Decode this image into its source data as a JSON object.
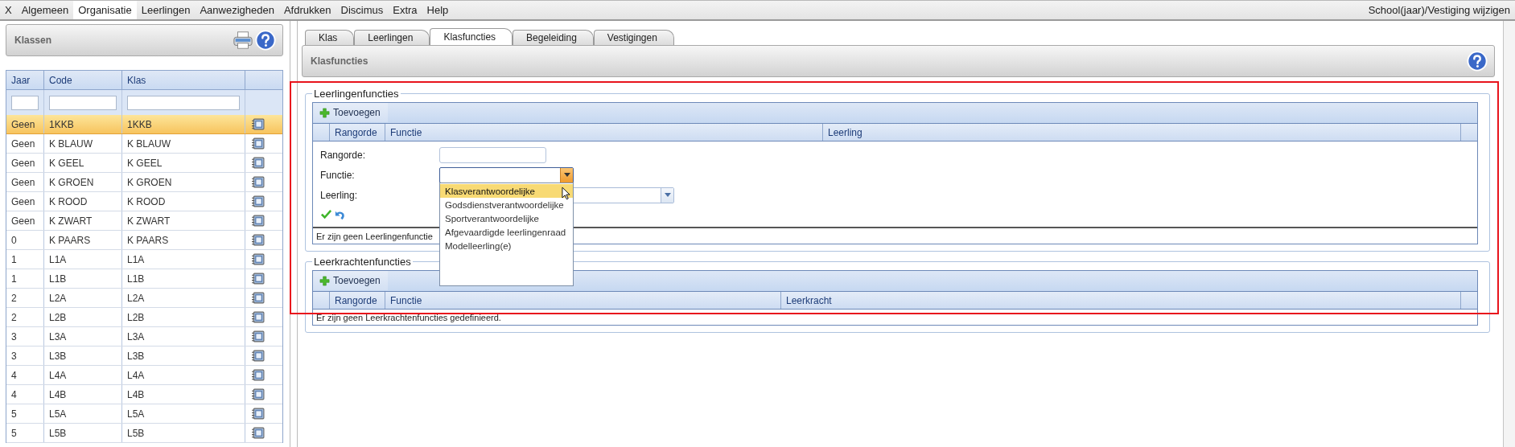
{
  "menu": [
    {
      "label": "X",
      "selected": false
    },
    {
      "label": "Algemeen",
      "selected": false
    },
    {
      "label": "Organisatie",
      "selected": true
    },
    {
      "label": "Leerlingen",
      "selected": false
    },
    {
      "label": "Aanwezigheden",
      "selected": false
    },
    {
      "label": "Afdrukken",
      "selected": false
    },
    {
      "label": "Discimus",
      "selected": false
    },
    {
      "label": "Extra",
      "selected": false
    },
    {
      "label": "Help",
      "selected": false
    }
  ],
  "menu_right": "School(jaar)/Vestiging wijzigen",
  "sidebar": {
    "title": "Klassen",
    "columns": [
      "Jaar",
      "Code",
      "Klas"
    ],
    "rows": [
      {
        "jaar": "Geen",
        "code": "1KKB",
        "klas": "1KKB",
        "selected": true
      },
      {
        "jaar": "Geen",
        "code": "K BLAUW",
        "klas": "K BLAUW",
        "selected": false
      },
      {
        "jaar": "Geen",
        "code": "K GEEL",
        "klas": "K GEEL",
        "selected": false
      },
      {
        "jaar": "Geen",
        "code": "K GROEN",
        "klas": "K GROEN",
        "selected": false
      },
      {
        "jaar": "Geen",
        "code": "K ROOD",
        "klas": "K ROOD",
        "selected": false
      },
      {
        "jaar": "Geen",
        "code": "K ZWART",
        "klas": "K ZWART",
        "selected": false
      },
      {
        "jaar": "0",
        "code": "K PAARS",
        "klas": "K PAARS",
        "selected": false
      },
      {
        "jaar": "1",
        "code": "L1A",
        "klas": "L1A",
        "selected": false
      },
      {
        "jaar": "1",
        "code": "L1B",
        "klas": "L1B",
        "selected": false
      },
      {
        "jaar": "2",
        "code": "L2A",
        "klas": "L2A",
        "selected": false
      },
      {
        "jaar": "2",
        "code": "L2B",
        "klas": "L2B",
        "selected": false
      },
      {
        "jaar": "3",
        "code": "L3A",
        "klas": "L3A",
        "selected": false
      },
      {
        "jaar": "3",
        "code": "L3B",
        "klas": "L3B",
        "selected": false
      },
      {
        "jaar": "4",
        "code": "L4A",
        "klas": "L4A",
        "selected": false
      },
      {
        "jaar": "4",
        "code": "L4B",
        "klas": "L4B",
        "selected": false
      },
      {
        "jaar": "5",
        "code": "L5A",
        "klas": "L5A",
        "selected": false
      },
      {
        "jaar": "5",
        "code": "L5B",
        "klas": "L5B",
        "selected": false
      }
    ]
  },
  "tabs": [
    {
      "label": "Klas",
      "selected": false
    },
    {
      "label": "Leerlingen",
      "selected": false
    },
    {
      "label": "Klasfuncties",
      "selected": true
    },
    {
      "label": "Begeleiding",
      "selected": false
    },
    {
      "label": "Vestigingen",
      "selected": false
    }
  ],
  "panel_title": "Klasfuncties",
  "leerlingenfuncties": {
    "legend": "Leerlingenfuncties",
    "add": "Toevoegen",
    "columns": [
      "Rangorde",
      "Functie",
      "Leerling"
    ],
    "form": {
      "rangorde_label": "Rangorde:",
      "functie_label": "Functie:",
      "leerling_label": "Leerling:"
    },
    "options": [
      {
        "label": "Klasverantwoordelijke",
        "selected": true
      },
      {
        "label": "Godsdienstverantwoordelijke",
        "selected": false
      },
      {
        "label": "Sportverantwoordelijke",
        "selected": false
      },
      {
        "label": "Afgevaardigde leerlingenraad",
        "selected": false
      },
      {
        "label": "Modelleerling(e)",
        "selected": false
      }
    ],
    "empty": "Er zijn geen Leerlingenfunctie"
  },
  "leerkrachtenfuncties": {
    "legend": "Leerkrachtenfuncties",
    "add": "Toevoegen",
    "columns": [
      "Rangorde",
      "Functie",
      "Leerkracht"
    ],
    "empty": "Er zijn geen Leerkrachtenfuncties gedefinieerd."
  }
}
